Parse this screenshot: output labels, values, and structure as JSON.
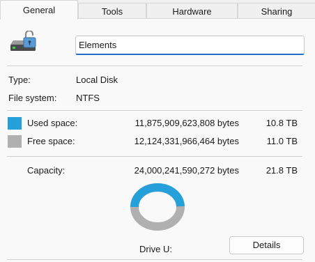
{
  "tabs": [
    {
      "label": "General",
      "active": true
    },
    {
      "label": "Tools",
      "active": false
    },
    {
      "label": "Hardware",
      "active": false
    },
    {
      "label": "Sharing",
      "active": false
    }
  ],
  "drive": {
    "icon": "unlocked-drive-icon",
    "name_value": "Elements"
  },
  "properties": {
    "type_label": "Type:",
    "type_value": "Local Disk",
    "fs_label": "File system:",
    "fs_value": "NTFS"
  },
  "space": {
    "used_label": "Used space:",
    "used_bytes": "11,875,909,623,808 bytes",
    "used_size": "10.8 TB",
    "free_label": "Free space:",
    "free_bytes": "12,124,331,966,464 bytes",
    "free_size": "11.0 TB",
    "capacity_label": "Capacity:",
    "capacity_bytes": "24,000,241,590,272 bytes",
    "capacity_size": "21.8 TB",
    "used_fraction": 0.4948
  },
  "drive_label": "Drive U:",
  "details_button": "Details",
  "colors": {
    "used": "#26a0da",
    "free": "#b0b0b0",
    "accent": "#1e6fc5"
  }
}
